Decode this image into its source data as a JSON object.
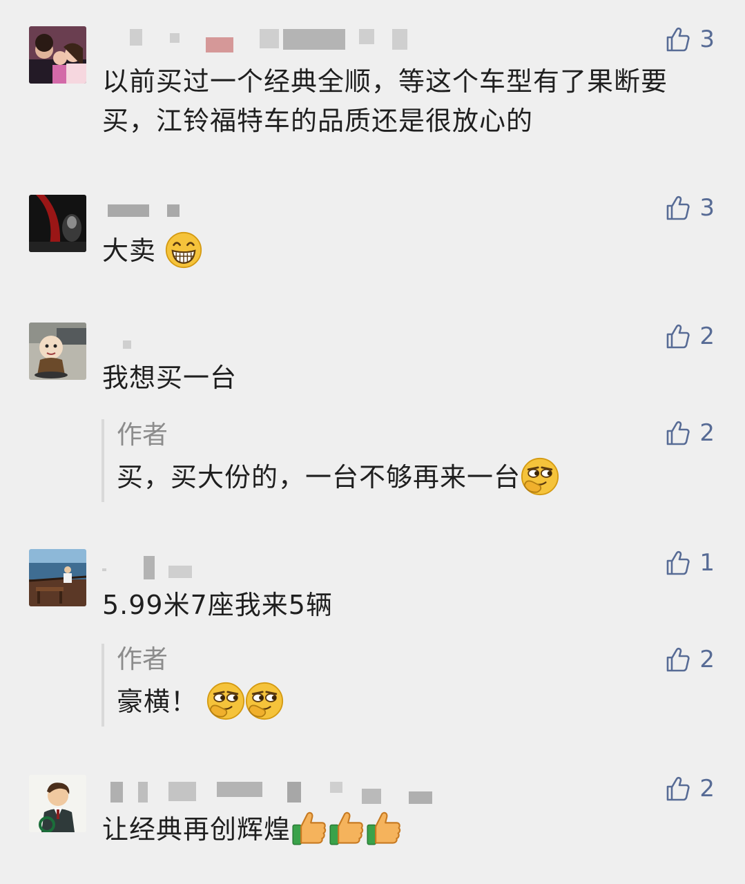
{
  "comments": [
    {
      "likes": "3",
      "text": "以前买过一个经典全顺，等这个车型有了果断要买，江铃福特车的品质还是很放心的"
    },
    {
      "likes": "3",
      "text": "大卖"
    },
    {
      "likes": "2",
      "text": "我想买一台",
      "reply": {
        "author": "作者",
        "likes": "2",
        "text": "买，买大份的，一台不够再来一台"
      }
    },
    {
      "likes": "1",
      "text": "5.99米7座我来5辆",
      "reply": {
        "author": "作者",
        "likes": "2",
        "text": "豪横！"
      }
    },
    {
      "likes": "2",
      "text": "让经典再创辉煌"
    }
  ],
  "icons": {
    "like": "thumbs-up-outline-icon"
  },
  "colors": {
    "like": "#576b95",
    "background": "#efefef"
  }
}
